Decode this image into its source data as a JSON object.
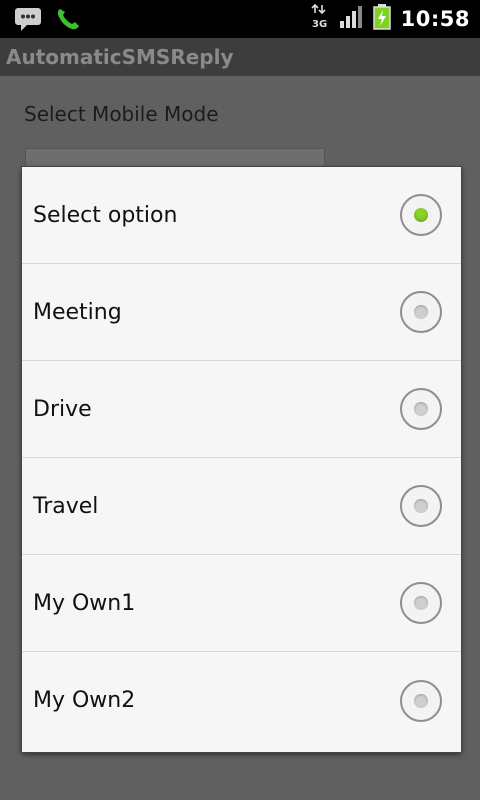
{
  "status_bar": {
    "time": "10:58",
    "network_label": "3G",
    "icons": [
      "sms-notification-icon",
      "phone-call-icon",
      "network-3g-icon",
      "signal-icon",
      "battery-charging-icon"
    ],
    "accent_color": "#7ed321"
  },
  "app": {
    "title": "AutomaticSMSReply"
  },
  "main": {
    "mode_label": "Select Mobile Mode"
  },
  "dialog": {
    "options": [
      {
        "label": "Select option",
        "selected": true
      },
      {
        "label": "Meeting",
        "selected": false
      },
      {
        "label": "Drive",
        "selected": false
      },
      {
        "label": "Travel",
        "selected": false
      },
      {
        "label": "My Own1",
        "selected": false
      },
      {
        "label": "My Own2",
        "selected": false
      }
    ],
    "selected_color": "#8bd12a"
  }
}
